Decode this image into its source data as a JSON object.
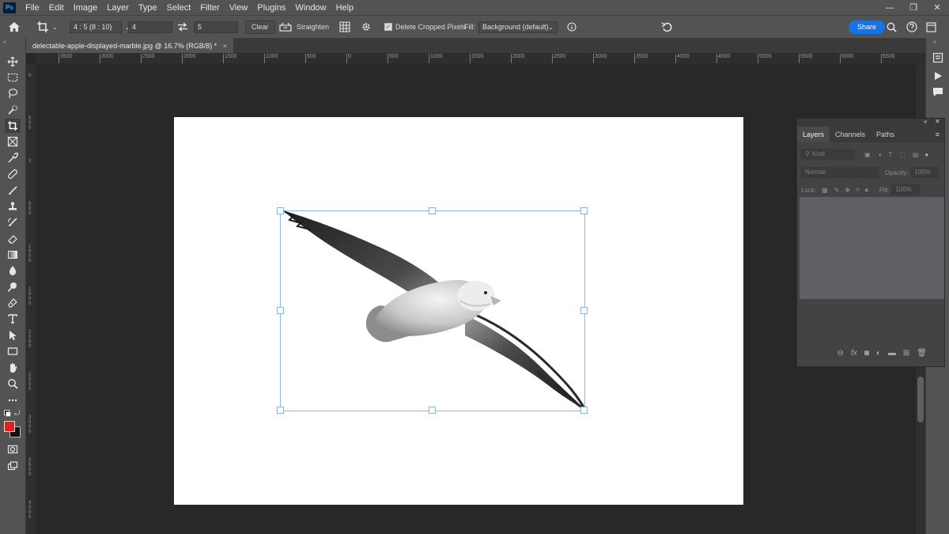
{
  "app": {
    "logo": "Ps"
  },
  "menu": [
    "File",
    "Edit",
    "Image",
    "Layer",
    "Type",
    "Select",
    "Filter",
    "View",
    "Plugins",
    "Window",
    "Help"
  ],
  "window_controls": {
    "minimize": "—",
    "restore": "❐",
    "close": "✕"
  },
  "options_bar": {
    "ratio_label": "4 : 5 (8 : 10)",
    "width_value": "4",
    "height_value": "5",
    "clear_label": "Clear",
    "straighten_label": "Straighten",
    "delete_cropped_label": "Delete Cropped Pixels",
    "delete_cropped_checked": true,
    "fill_label": "Fill:",
    "fill_value": "Background (default)",
    "share_label": "Share"
  },
  "document": {
    "tab_title": "delectable-apple-displayed-marble.jpg @ 16.7% (RGB/8) *",
    "close": "×"
  },
  "ruler": {
    "h_labels": [
      "3500",
      "3000",
      "2500",
      "2000",
      "1500",
      "1000",
      "500",
      "0",
      "500",
      "1000",
      "1500",
      "2000",
      "2500",
      "3000",
      "3500",
      "4000",
      "4500",
      "5000",
      "5500",
      "6000",
      "6500"
    ],
    "v_labels": [
      "0",
      "500",
      "0",
      "500",
      "1000",
      "1500",
      "2000",
      "2500",
      "3000",
      "3500",
      "4000"
    ]
  },
  "layers_panel": {
    "tabs": [
      "Layers",
      "Channels",
      "Paths"
    ],
    "active_tab": "Layers",
    "kind_label": "Kind",
    "blend_mode": "Normal",
    "opacity_label": "Opacity:",
    "opacity_value": "100%",
    "lock_label": "Lock:",
    "fill_label": "Fill:",
    "fill_value": "100%"
  },
  "colors": {
    "foreground": "#e02020",
    "background": "#111111",
    "accent": "#1473e6",
    "crop_frame": "#8fb5e0"
  }
}
